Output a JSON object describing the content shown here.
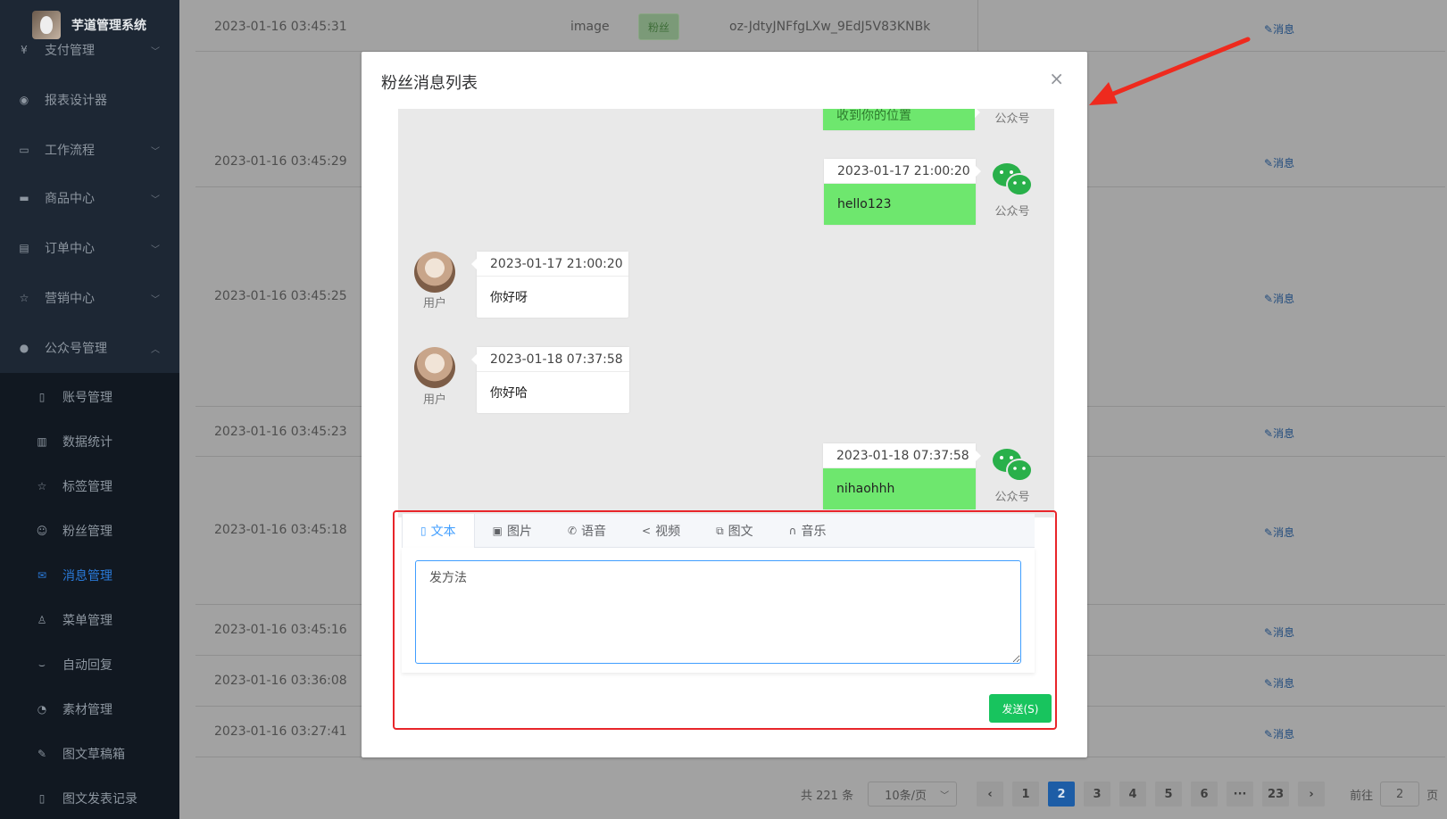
{
  "sidebar": {
    "app_title": "芋道管理系统",
    "menu": [
      {
        "label": "支付管理",
        "icon": "yen-icon"
      },
      {
        "label": "报表设计器",
        "icon": "report-icon"
      },
      {
        "label": "工作流程",
        "icon": "workflow-icon"
      },
      {
        "label": "商品中心",
        "icon": "shop-icon"
      },
      {
        "label": "订单中心",
        "icon": "order-icon"
      },
      {
        "label": "营销中心",
        "icon": "star-icon"
      },
      {
        "label": "公众号管理",
        "icon": "wechat-icon"
      }
    ],
    "submenu": [
      {
        "label": "账号管理",
        "icon": "phone-icon"
      },
      {
        "label": "数据统计",
        "icon": "chart-icon"
      },
      {
        "label": "标签管理",
        "icon": "star-icon"
      },
      {
        "label": "粉丝管理",
        "icon": "user-group-icon"
      },
      {
        "label": "消息管理",
        "icon": "mail-icon"
      },
      {
        "label": "菜单管理",
        "icon": "menu-icon"
      },
      {
        "label": "自动回复",
        "icon": "reply-icon"
      },
      {
        "label": "素材管理",
        "icon": "material-icon"
      },
      {
        "label": "图文草稿箱",
        "icon": "edit-icon"
      },
      {
        "label": "图文发表记录",
        "icon": "book-icon"
      }
    ]
  },
  "table": {
    "first_row": {
      "type": "image",
      "tag": "粉丝",
      "openid": "oz-JdtyJNFfgLXw_9EdJ5V83KNBk"
    },
    "message_link": "消息",
    "rows": [
      "2023-01-16 03:45:31",
      "2023-01-16 03:45:29",
      "2023-01-16 03:45:25",
      "2023-01-16 03:45:23",
      "2023-01-16 03:45:18",
      "2023-01-16 03:45:16",
      "2023-01-16 03:36:08",
      "2023-01-16 03:27:41"
    ]
  },
  "pagination": {
    "total": "共 221 条",
    "page_size": "10条/页",
    "pages": [
      "1",
      "2",
      "3",
      "4",
      "5",
      "6",
      "···",
      "23"
    ],
    "current": "2",
    "goto_label": "前往",
    "goto_value": "2",
    "page_unit": "页"
  },
  "modal": {
    "title": "粉丝消息列表",
    "close": "×",
    "partial_message": "收到你的位置",
    "messages": [
      {
        "time": "2023-01-17 21:00:20",
        "text": "hello123",
        "sender": "公众号"
      },
      {
        "time": "2023-01-17 21:00:20",
        "text": "你好呀",
        "sender": "用户"
      },
      {
        "time": "2023-01-18 07:37:58",
        "text": "你好哈",
        "sender": "用户"
      },
      {
        "time": "2023-01-18 07:37:58",
        "text": "nihaohhh",
        "sender": "公众号"
      }
    ],
    "tabs": [
      {
        "label": "文本",
        "icon": "document-icon"
      },
      {
        "label": "图片",
        "icon": "picture-icon"
      },
      {
        "label": "语音",
        "icon": "phone-icon"
      },
      {
        "label": "视频",
        "icon": "share-icon"
      },
      {
        "label": "图文",
        "icon": "news-icon"
      },
      {
        "label": "音乐",
        "icon": "headset-icon"
      }
    ],
    "input_value": "发方法",
    "send_label": "发送(S)"
  },
  "colors": {
    "accent": "#409eff",
    "send": "#18c45e",
    "bubble_green": "#6ee76e",
    "highlight": "#e8252a"
  }
}
